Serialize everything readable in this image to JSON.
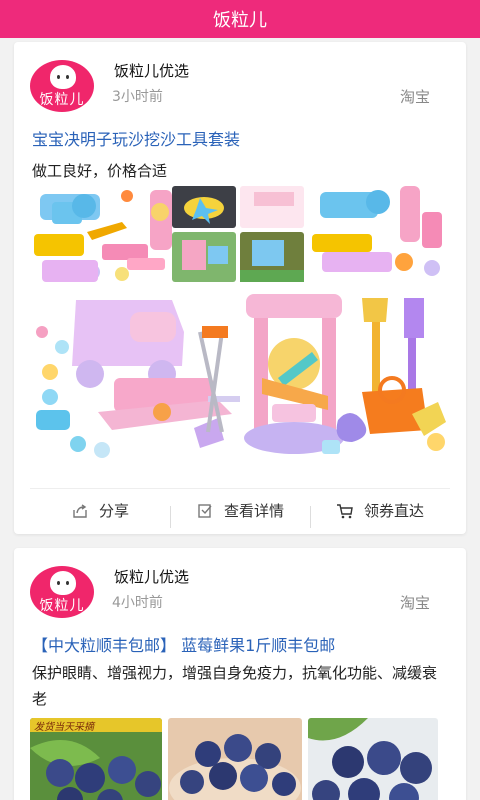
{
  "app": {
    "title": "饭粒儿"
  },
  "feed": [
    {
      "avatar_text": "饭粒儿",
      "shop": "饭粒儿优选",
      "time": "3小时前",
      "source": "淘宝",
      "title": "宝宝决明子玩沙挖沙工具套装",
      "description": "做工良好，价格合适",
      "product_image": "beach-sand-toy-set-collage",
      "actions": {
        "share": "分享",
        "details": "查看详情",
        "coupon": "领券直达"
      }
    },
    {
      "avatar_text": "饭粒儿",
      "shop": "饭粒儿优选",
      "time": "4小时前",
      "source": "淘宝",
      "title": "【中大粒顺丰包邮】 蓝莓鲜果1斤顺丰包邮",
      "description": "保护眼睛、增强视力，增强自身免疫力，抗氧化功能、减缓衰老",
      "image_banner": "发货当天采摘",
      "product_images": [
        "blueberries-on-leaves",
        "blueberries-in-bowl",
        "blueberries-closeup"
      ]
    }
  ],
  "colors": {
    "brand": "#ee2a7b",
    "link": "#2a62b8"
  }
}
